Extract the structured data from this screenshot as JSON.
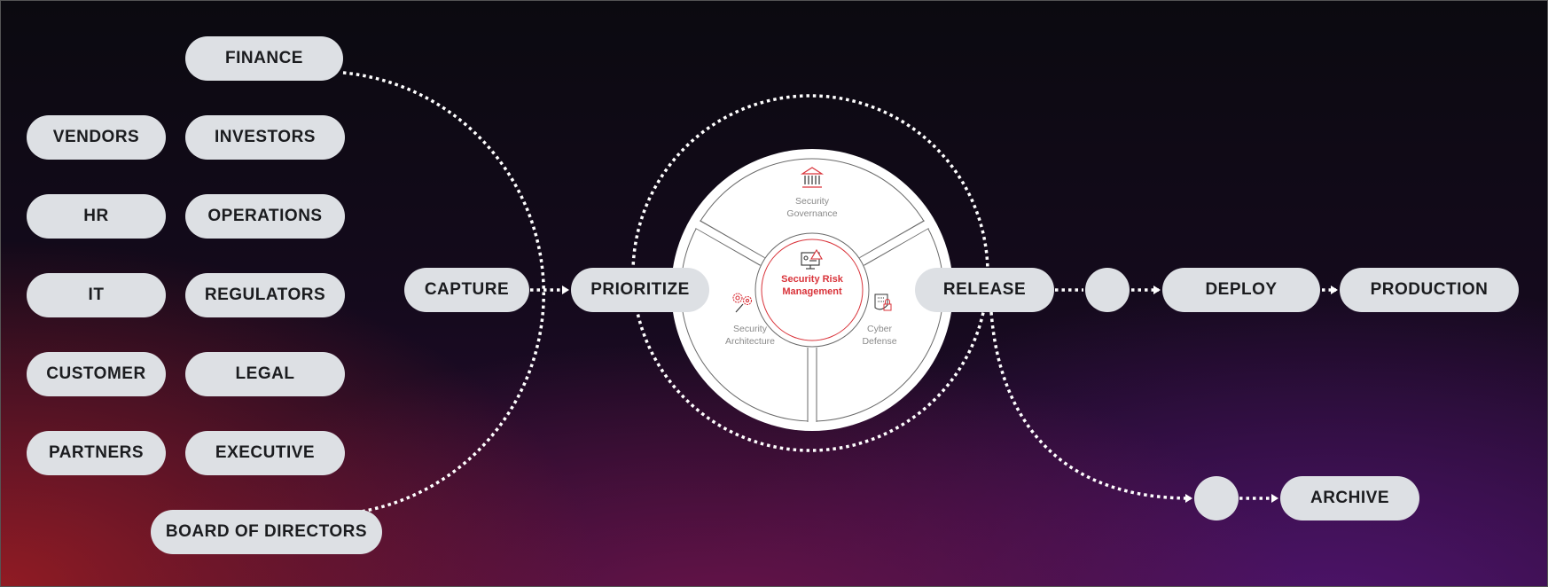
{
  "stakeholders": {
    "finance": "FINANCE",
    "vendors": "VENDORS",
    "investors": "INVESTORS",
    "hr": "HR",
    "operations": "OPERATIONS",
    "it": "IT",
    "regulators": "REGULATORS",
    "customer": "CUSTOMER",
    "legal": "LEGAL",
    "partners": "PARTNERS",
    "executive": "EXECUTIVE",
    "board": "BOARD OF DIRECTORS"
  },
  "flow": {
    "capture": "CAPTURE",
    "prioritize": "PRIORITIZE",
    "release": "RELEASE",
    "deploy": "DEPLOY",
    "production": "PRODUCTION",
    "archive": "ARCHIVE"
  },
  "wheel": {
    "center": {
      "line1": "Security Risk",
      "line2": "Management",
      "icon": "monitor-warning-icon"
    },
    "governance": {
      "line1": "Security",
      "line2": "Governance",
      "icon": "bank-building-icon"
    },
    "architecture": {
      "line1": "Security",
      "line2": "Architecture",
      "icon": "gears-wrench-icon"
    },
    "defense": {
      "line1": "Cyber",
      "line2": "Defense",
      "icon": "binary-lock-icon"
    }
  },
  "colors": {
    "accent_red": "#d9333a",
    "pill": "#dde0e4",
    "connector": "#ffffff"
  }
}
